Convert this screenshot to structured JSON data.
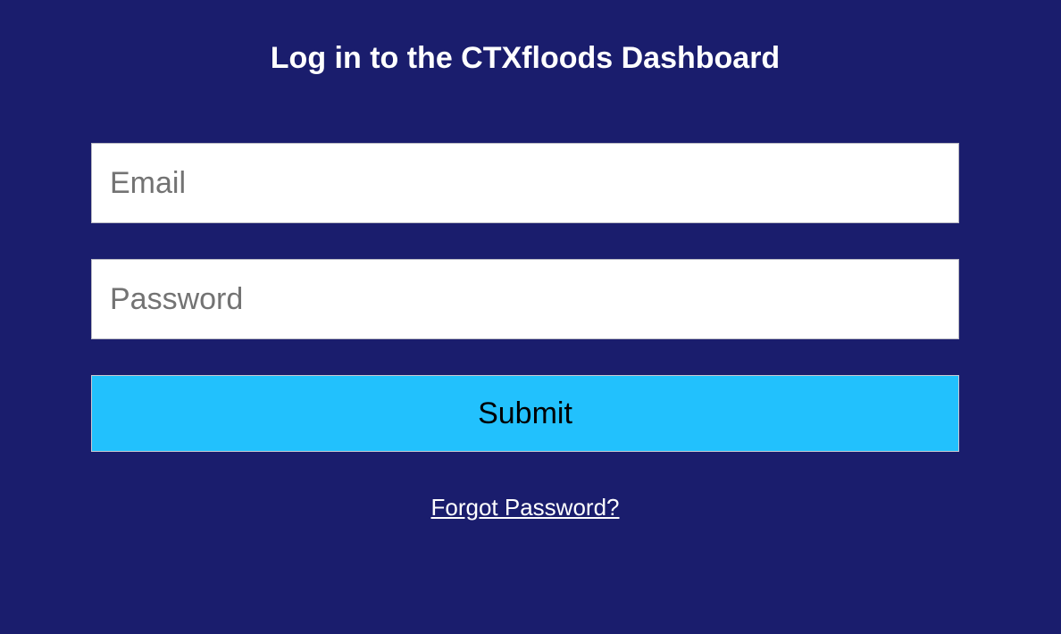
{
  "page": {
    "title": "Log in to the CTXfloods Dashboard"
  },
  "form": {
    "email": {
      "placeholder": "Email",
      "value": ""
    },
    "password": {
      "placeholder": "Password",
      "value": ""
    },
    "submit_label": "Submit",
    "forgot_password_label": "Forgot Password?"
  },
  "colors": {
    "background": "#1a1d6d",
    "submit_button": "#22c1fd",
    "text_light": "#ffffff"
  }
}
